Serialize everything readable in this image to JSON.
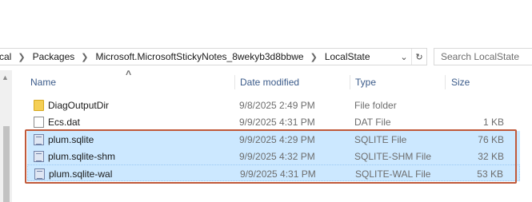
{
  "address_bar": {
    "segments": [
      "cal",
      "Packages",
      "Microsoft.MicrosoftStickyNotes_8wekyb3d8bbwe",
      "LocalState"
    ],
    "dropdown_icon": "chevron-down-icon",
    "refresh_icon": "refresh-icon"
  },
  "search": {
    "placeholder": "Search LocalState"
  },
  "columns": {
    "name": "Name",
    "date": "Date modified",
    "type": "Type",
    "size": "Size"
  },
  "files": [
    {
      "name": "DiagOutputDir",
      "date": "9/8/2025 2:49 PM",
      "type": "File folder",
      "size": "",
      "icon": "folder-icon"
    },
    {
      "name": "Ecs.dat",
      "date": "9/9/2025 4:31 PM",
      "type": "DAT File",
      "size": "1 KB",
      "icon": "file-icon"
    },
    {
      "name": "plum.sqlite",
      "date": "9/9/2025 4:29 PM",
      "type": "SQLITE File",
      "size": "76 KB",
      "icon": "database-file-icon"
    },
    {
      "name": "plum.sqlite-shm",
      "date": "9/9/2025 4:32 PM",
      "type": "SQLITE-SHM File",
      "size": "32 KB",
      "icon": "database-file-icon"
    },
    {
      "name": "plum.sqlite-wal",
      "date": "9/9/2025 4:31 PM",
      "type": "SQLITE-WAL File",
      "size": "53 KB",
      "icon": "database-file-icon"
    }
  ],
  "colors": {
    "annotation_border": "#c0593a",
    "header_text": "#3b5b8a",
    "selection": "#cce8ff"
  }
}
